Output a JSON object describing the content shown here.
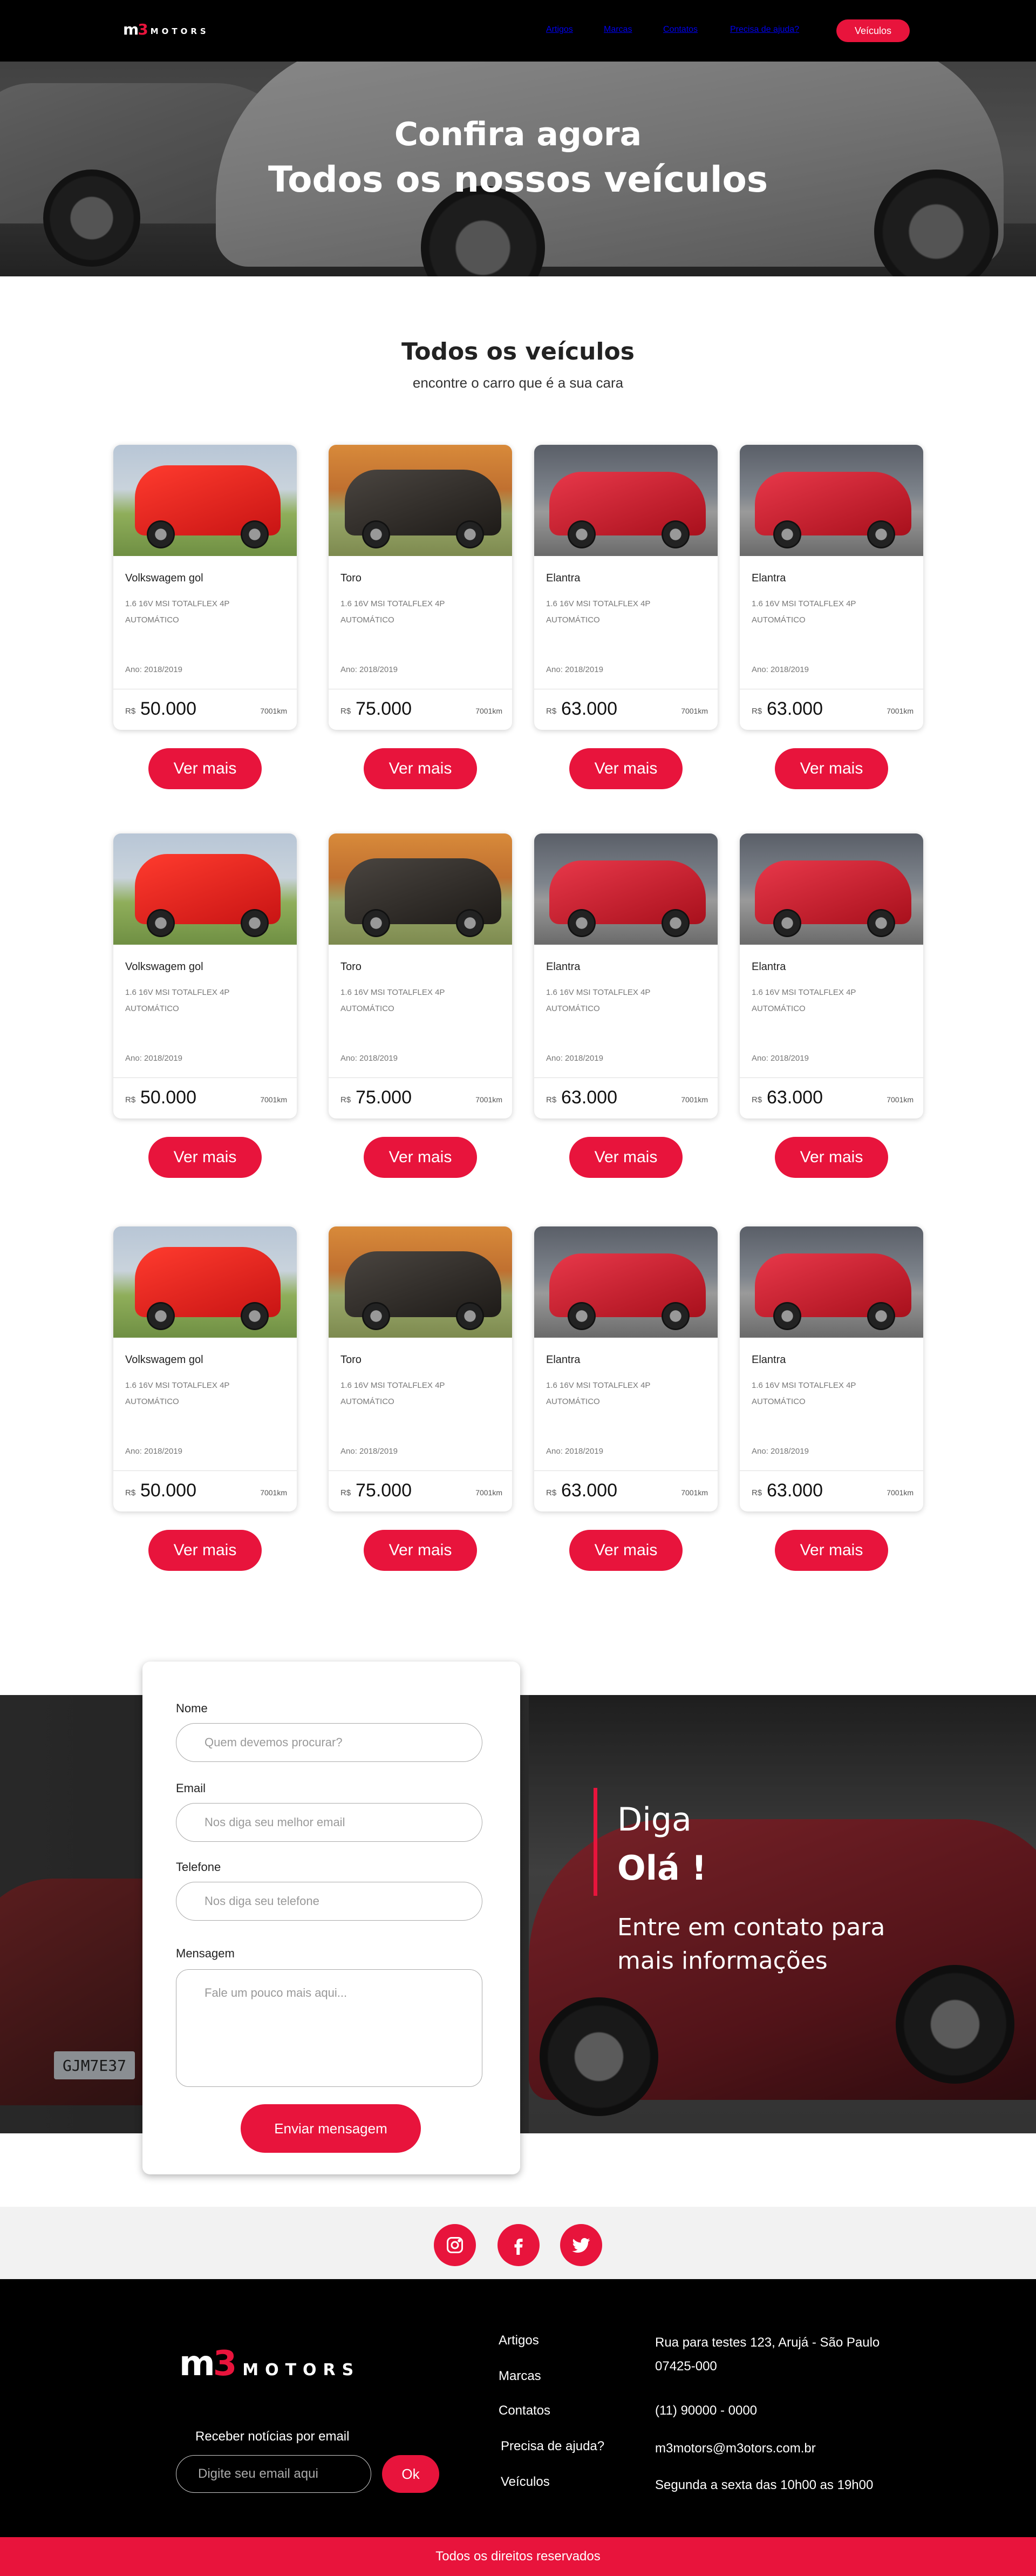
{
  "brand": {
    "logo_prefix": "m",
    "logo_accent": "3",
    "logo_word": "MOTORS",
    "accent_color": "#e8143c"
  },
  "nav": {
    "items": [
      "Artigos",
      "Marcas",
      "Contatos",
      "Precisa de ajuda?"
    ],
    "cta": "Veículos"
  },
  "hero": {
    "line1": "Confira agora",
    "line2": "Todos os nossos veículos"
  },
  "listing": {
    "title": "Todos os veículos",
    "subtitle": "encontre o carro que é a sua cara",
    "currency": "R$",
    "button_label": "Ver mais",
    "cars": [
      {
        "model": "Volkswagem gol",
        "spec": "1.6 16v MSI TOTALFLEX 4P AUTOMÁTICO",
        "year": "Ano: 2018/2019",
        "price": "50.000",
        "km": "7001km",
        "image": "red-hatchback"
      },
      {
        "model": "Toro",
        "spec": "1.6 16v MSI TOTALFLEX 4P AUTOMÁTICO",
        "year": "Ano: 2018/2019",
        "price": "75.000",
        "km": "7001km",
        "image": "dark-pickup"
      },
      {
        "model": "Elantra",
        "spec": "1.6 16v MSI TOTALFLEX 4P AUTOMÁTICO",
        "year": "Ano: 2018/2019",
        "price": "63.000",
        "km": "7001km",
        "image": "red-sedan"
      },
      {
        "model": "Elantra",
        "spec": "1.6 16v MSI TOTALFLEX 4P AUTOMÁTICO",
        "year": "Ano: 2018/2019",
        "price": "63.000",
        "km": "7001km",
        "image": "red-sedan"
      },
      {
        "model": "Volkswagem gol",
        "spec": "1.6 16v MSI TOTALFLEX 4P AUTOMÁTICO",
        "year": "Ano: 2018/2019",
        "price": "50.000",
        "km": "7001km",
        "image": "red-hatchback"
      },
      {
        "model": "Toro",
        "spec": "1.6 16v MSI TOTALFLEX 4P AUTOMÁTICO",
        "year": "Ano: 2018/2019",
        "price": "75.000",
        "km": "7001km",
        "image": "dark-pickup"
      },
      {
        "model": "Elantra",
        "spec": "1.6 16v MSI TOTALFLEX 4P AUTOMÁTICO",
        "year": "Ano: 2018/2019",
        "price": "63.000",
        "km": "7001km",
        "image": "red-sedan"
      },
      {
        "model": "Elantra",
        "spec": "1.6 16v MSI TOTALFLEX 4P AUTOMÁTICO",
        "year": "Ano: 2018/2019",
        "price": "63.000",
        "km": "7001km",
        "image": "red-sedan"
      },
      {
        "model": "Volkswagem gol",
        "spec": "1.6 16v MSI TOTALFLEX 4P AUTOMÁTICO",
        "year": "Ano: 2018/2019",
        "price": "50.000",
        "km": "7001km",
        "image": "red-hatchback"
      },
      {
        "model": "Toro",
        "spec": "1.6 16v MSI TOTALFLEX 4P AUTOMÁTICO",
        "year": "Ano: 2018/2019",
        "price": "75.000",
        "km": "7001km",
        "image": "dark-pickup"
      },
      {
        "model": "Elantra",
        "spec": "1.6 16v MSI TOTALFLEX 4P AUTOMÁTICO",
        "year": "Ano: 2018/2019",
        "price": "63.000",
        "km": "7001km",
        "image": "red-sedan"
      },
      {
        "model": "Elantra",
        "spec": "1.6 16v MSI TOTALFLEX 4P AUTOMÁTICO",
        "year": "Ano: 2018/2019",
        "price": "63.000",
        "km": "7001km",
        "image": "red-sedan"
      }
    ]
  },
  "contact": {
    "plate": "GJM7E37",
    "heading1": "Diga",
    "heading2": "Olá !",
    "text": "Entre em contato para mais  informações",
    "form": {
      "name_label": "Nome",
      "name_placeholder": "Quem devemos procurar?",
      "email_label": "Email",
      "email_placeholder": "Nos diga seu melhor email",
      "phone_label": "Telefone",
      "phone_placeholder": "Nos diga seu telefone",
      "message_label": "Mensagem",
      "message_placeholder": "Fale um pouco mais aqui...",
      "submit": "Enviar mensagem"
    }
  },
  "social": [
    "instagram-icon",
    "facebook-icon",
    "twitter-icon"
  ],
  "footer": {
    "newsletter_label": "Receber notícias por email",
    "newsletter_placeholder": "Digite seu email aqui",
    "newsletter_button": "Ok",
    "links": [
      "Artigos",
      "Marcas",
      "Contatos",
      "Precisa de ajuda?",
      "Veículos"
    ],
    "address_line1": "Rua para testes  123,  Arujá  - São Paulo",
    "address_line2": "07425-000",
    "phone": "(11) 90000 - 0000",
    "email": "m3motors@m3otors.com.br",
    "hours": "Segunda a sexta das 10h00 as 19h00",
    "copyright": "Todos os direitos reservados"
  }
}
